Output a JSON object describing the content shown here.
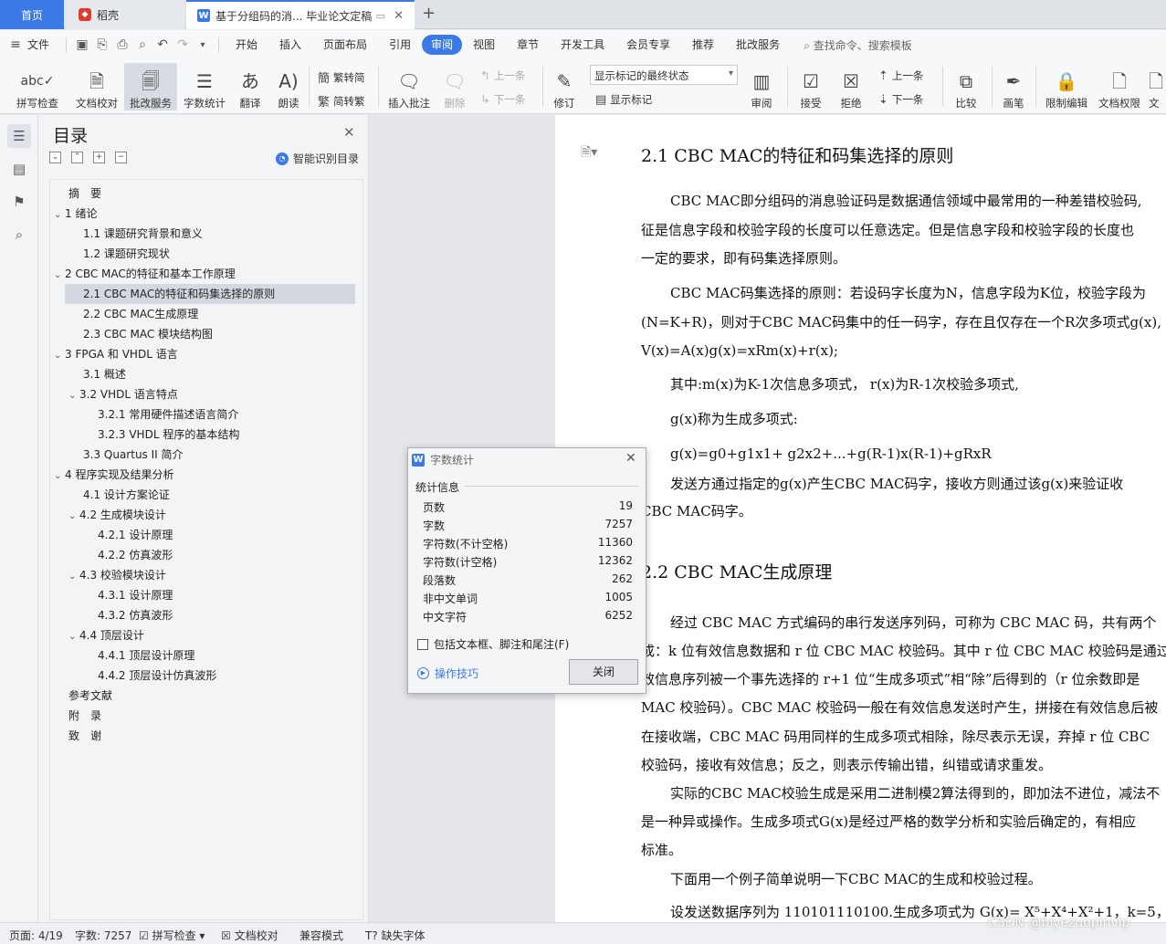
{
  "tabs": {
    "home": "首页",
    "daoke": "稻壳",
    "doc": "基于分组码的消... 毕业论文定稿"
  },
  "menu": {
    "file": "文件",
    "items": [
      "开始",
      "插入",
      "页面布局",
      "引用",
      "审阅",
      "视图",
      "章节",
      "开发工具",
      "会员专享",
      "推荐",
      "批改服务"
    ],
    "active": "审阅",
    "search": "查找命令、搜索模板"
  },
  "ribbon": {
    "spell": "拼写检查",
    "proof": "文档校对",
    "review_service": "批改服务",
    "wordcount": "字数统计",
    "translate": "翻译",
    "read": "朗读",
    "trad": "繁转简",
    "simp": "简转繁",
    "insert_comment": "插入批注",
    "delete": "删除",
    "prev_c": "上一条",
    "next_c": "下一条",
    "revise": "修订",
    "markup_state": "显示标记的最终状态",
    "show_markup": "显示标记",
    "review": "审阅",
    "accept": "接受",
    "reject": "拒绝",
    "prev": "上一条",
    "next": "下一条",
    "compare": "比较",
    "pen": "画笔",
    "restrict": "限制编辑",
    "doc_perm": "文档权限",
    "doc_more": "文"
  },
  "toc": {
    "title": "目录",
    "smart": "智能识别目录",
    "items": [
      {
        "text": "摘　要",
        "level": 1,
        "chev": ""
      },
      {
        "text": "1  绪论",
        "level": 1,
        "chev": "v"
      },
      {
        "text": "1.1  课题研究背景和意义",
        "level": 2,
        "chev": ""
      },
      {
        "text": "1.2  课题研究现状",
        "level": 2,
        "chev": ""
      },
      {
        "text": "2 CBC MAC的特征和基本工作原理",
        "level": 1,
        "chev": "v"
      },
      {
        "text": "2.1 CBC MAC的特征和码集选择的原则",
        "level": 2,
        "chev": "",
        "sel": true
      },
      {
        "text": "2.2     CBC MAC生成原理",
        "level": 2,
        "chev": ""
      },
      {
        "text": "2.3 CBC MAC 模块结构图",
        "level": 2,
        "chev": ""
      },
      {
        "text": "3 FPGA 和 VHDL 语言",
        "level": 1,
        "chev": "v"
      },
      {
        "text": "3.1  概述",
        "level": 2,
        "chev": ""
      },
      {
        "text": "3.2 VHDL 语言特点",
        "level": 2,
        "chev": "v"
      },
      {
        "text": "3.2.1  常用硬件描述语言简介",
        "level": 3,
        "chev": ""
      },
      {
        "text": "3.2.3 VHDL 程序的基本结构",
        "level": 3,
        "chev": ""
      },
      {
        "text": "3.3 Quartus II  简介",
        "level": 2,
        "chev": ""
      },
      {
        "text": "4  程序实现及结果分析",
        "level": 1,
        "chev": "v"
      },
      {
        "text": "4.1  设计方案论证",
        "level": 2,
        "chev": ""
      },
      {
        "text": "4.2  生成模块设计",
        "level": 2,
        "chev": "v"
      },
      {
        "text": "4.2.1  设计原理",
        "level": 3,
        "chev": ""
      },
      {
        "text": "4.2.2  仿真波形",
        "level": 3,
        "chev": ""
      },
      {
        "text": "4.3  校验模块设计",
        "level": 2,
        "chev": "v"
      },
      {
        "text": "4.3.1  设计原理",
        "level": 3,
        "chev": ""
      },
      {
        "text": "4.3.2  仿真波形",
        "level": 3,
        "chev": ""
      },
      {
        "text": "4.4  顶层设计",
        "level": 2,
        "chev": "v"
      },
      {
        "text": "4.4.1  顶层设计原理",
        "level": 3,
        "chev": ""
      },
      {
        "text": "4.4.2  顶层设计仿真波形",
        "level": 3,
        "chev": ""
      },
      {
        "text": "参考文献",
        "level": 1,
        "chev": ""
      },
      {
        "text": "附　录",
        "level": 1,
        "chev": ""
      },
      {
        "text": "致　谢",
        "level": 1,
        "chev": ""
      }
    ]
  },
  "doc": {
    "h1": "2.1 CBC MAC的特征和码集选择的原则",
    "p1": [
      " CBC MAC即分组码的消息验证码是数据通信领域中最常用的一种差错校验码,",
      "征是信息字段和校验字段的长度可以任意选定。但是信息字段和校验字段的长度也",
      "一定的要求，即有码集选择原则。"
    ],
    "p2": [
      "CBC MAC码集选择的原则：若设码字长度为N，信息字段为K位，校验字段为",
      "(N=K+R)，则对于CBC MAC码集中的任一码字，存在且仅存在一个R次多项式g(x),",
      "V(x)=A(x)g(x)=xRm(x)+r(x);"
    ],
    "p3": "其中:m(x)为K-1次信息多项式，  r(x)为R-1次校验多项式,",
    "p4": "g(x)称为生成多项式:",
    "p5": "g(x)=g0+g1x1+ g2x2+...+g(R-1)x(R-1)+gRxR",
    "p6": [
      "    发送方通过指定的g(x)产生CBC MAC码字，接收方则通过该g(x)来验证收",
      "CBC MAC码字。"
    ],
    "h2": "2.2    CBC MAC生成原理",
    "p7": [
      "经过 CBC MAC 方式编码的串行发送序列码，可称为 CBC MAC 码，共有两个",
      "成：k 位有效信息数据和 r 位 CBC MAC 校验码。其中 r 位 CBC MAC 校验码是通过",
      "效信息序列被一个事先选择的 r+1 位“生成多项式”相“除”后得到的（r 位余数即是",
      "MAC 校验码）。CBC MAC 校验码一般在有效信息发送时产生，拼接在有效信息后被",
      "在接收端，CBC MAC 码用同样的生成多项式相除，除尽表示无误，弃掉 r 位 CBC",
      "校验码，接收有效信息；反之，则表示传输出错，纠错或请求重发。"
    ],
    "p8": [
      "实际的CBC MAC校验生成是采用二进制模2算法得到的，即加法不进位，减法不",
      "是一种异或操作。生成多项式G(x)是经过严格的数学分析和实验后确定的，有相应",
      "标准。"
    ],
    "p9": "下面用一个例子简单说明一下CBC MAC的生成和校验过程。",
    "p10": "设发送数据序列为 110101110100.生成多项式为 G(x)=  X⁵+X⁴+X²+1，k=5，"
  },
  "dialog": {
    "title": "字数统计",
    "section": "统计信息",
    "stats": [
      {
        "label": "页数",
        "value": "19"
      },
      {
        "label": "字数",
        "value": "7257"
      },
      {
        "label": "字符数(不计空格)",
        "value": "11360"
      },
      {
        "label": "字符数(计空格)",
        "value": "12362"
      },
      {
        "label": "段落数",
        "value": "262"
      },
      {
        "label": "非中文单词",
        "value": "1005"
      },
      {
        "label": "中文字符",
        "value": "6252"
      }
    ],
    "checkbox": "包括文本框、脚注和尾注(F)",
    "tips": "操作技巧",
    "close": "关闭"
  },
  "status": {
    "page": "页面: 4/19",
    "words": "字数: 7257",
    "spell": "拼写检查",
    "proof": "文档校对",
    "compat": "兼容模式",
    "missing_font": "缺失字体"
  },
  "watermark": "CSDN @biyezuopinvip"
}
